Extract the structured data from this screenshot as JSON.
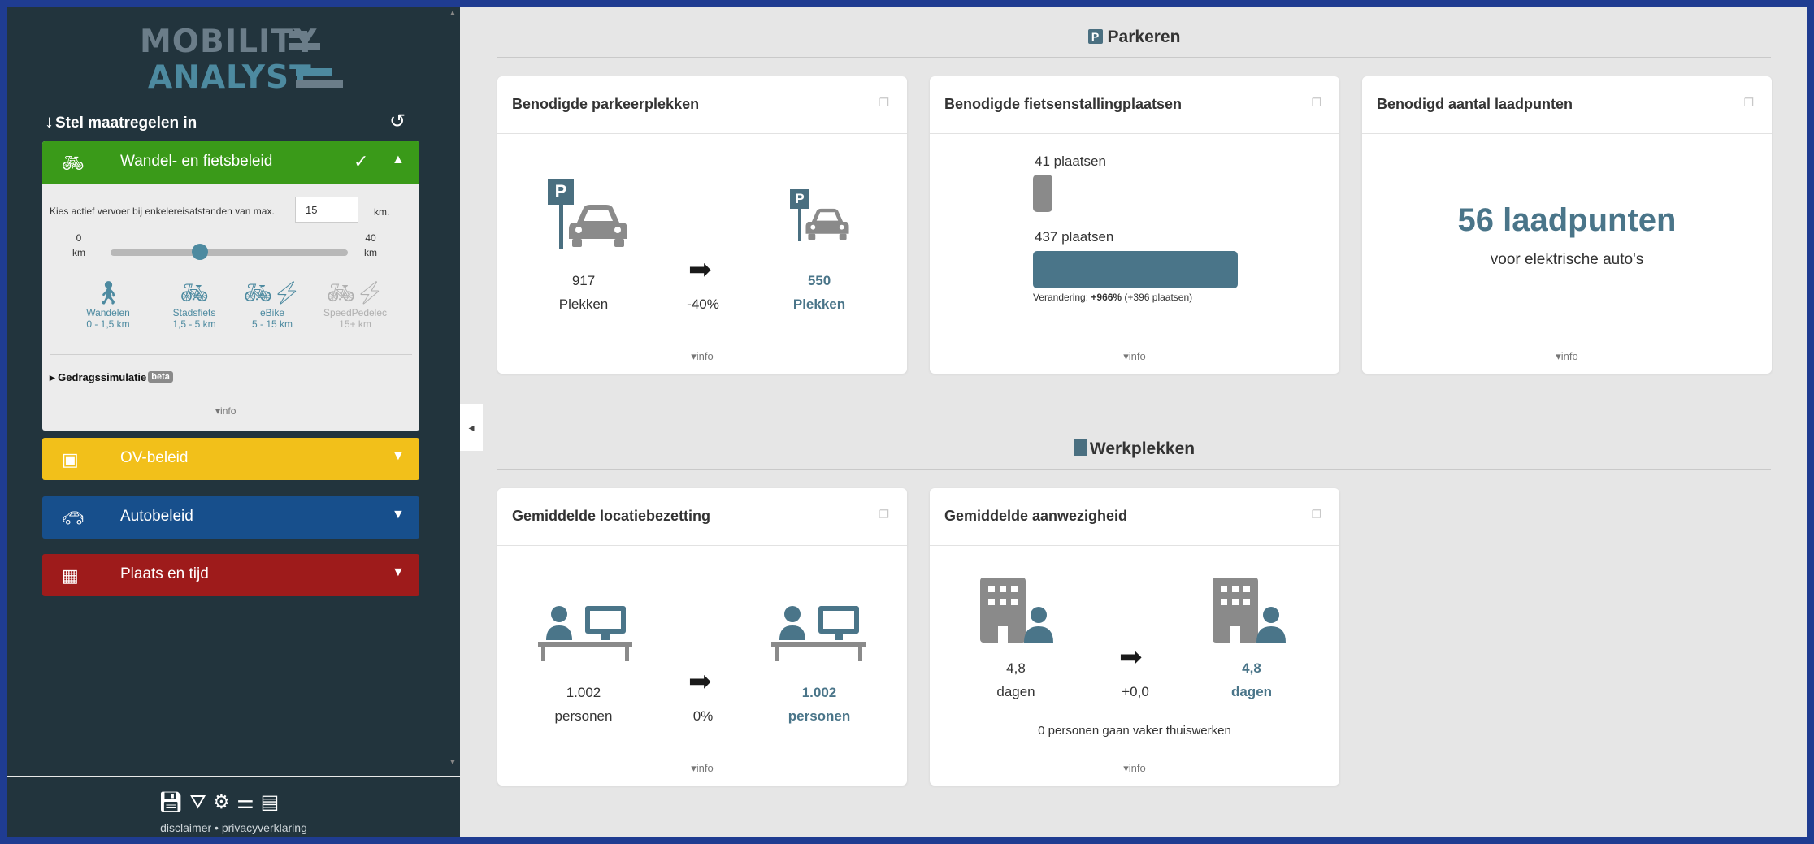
{
  "sidebar": {
    "logo_line1": "MOBILITY",
    "logo_line2": "ANALYST",
    "maatregel_title": "Stel maatregelen in",
    "panels": {
      "walkbike": {
        "label": "Wandel- en fietsbeleid",
        "kies_text": "Kies actief vervoer bij enkelereisafstanden van max.",
        "km_value": "15",
        "km_unit": "km.",
        "slider_min": "0",
        "slider_max": "40",
        "slider_unit": "km",
        "slider_value": 15,
        "modes": [
          {
            "name": "Wandelen",
            "range": "0 - 1,5 km"
          },
          {
            "name": "Stadsfiets",
            "range": "1,5 - 5 km"
          },
          {
            "name": "eBike",
            "range": "5 - 15 km"
          },
          {
            "name": "SpeedPedelec",
            "range": "15+ km"
          }
        ],
        "gedrag_label": "Gedragssimulatie",
        "beta": "beta",
        "info": "info"
      },
      "ov": {
        "label": "OV-beleid"
      },
      "auto": {
        "label": "Autobeleid"
      },
      "plaats": {
        "label": "Plaats en tijd"
      }
    },
    "footer_links": "disclaimer • privacyverklaring"
  },
  "sections": {
    "parkeren": {
      "title": "Parkeren",
      "icon": "P"
    },
    "werkplekken": {
      "title": "Werkplekken"
    }
  },
  "cards": {
    "parkeerplekken": {
      "title": "Benodigde parkeerplekken",
      "before_value": "917",
      "before_unit": "Plekken",
      "change": "-40%",
      "after_value": "550",
      "after_unit": "Plekken",
      "info": "info"
    },
    "fiets": {
      "title": "Benodigde fietsenstallingplaatsen",
      "small_label": "41 plaatsen",
      "small_value": 41,
      "big_label": "437 plaatsen",
      "big_value": 437,
      "change_prefix": "Verandering: ",
      "change_pct": "+966%",
      "change_rest": " (+396 plaatsen)",
      "info": "info"
    },
    "laadpunten": {
      "title": "Benodigd aantal laadpunten",
      "value": "56 laadpunten",
      "sub": "voor elektrische auto's",
      "info": "info"
    },
    "bezetting": {
      "title": "Gemiddelde locatiebezetting",
      "before_value": "1.002",
      "before_unit": "personen",
      "change": "0%",
      "after_value": "1.002",
      "after_unit": "personen",
      "info": "info"
    },
    "aanwezigheid": {
      "title": "Gemiddelde aanwezigheid",
      "before_value": "4,8",
      "before_unit": "dagen",
      "change": "+0,0",
      "after_value": "4,8",
      "after_unit": "dagen",
      "note": "0 personen gaan vaker thuiswerken",
      "info": "info"
    }
  },
  "colors": {
    "green": "#3a9a19",
    "yellow": "#f2c01a",
    "blue": "#174f8c",
    "red": "#9e1b1b",
    "teal": "#4a7589",
    "sidebar": "#22343d"
  }
}
